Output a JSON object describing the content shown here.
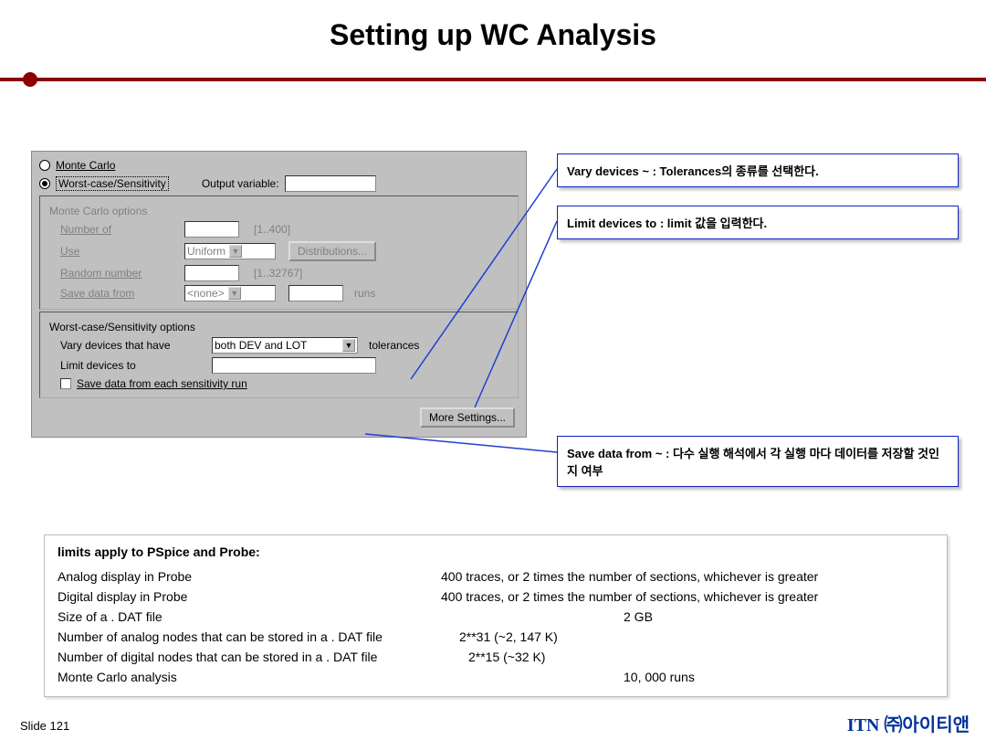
{
  "title": "Setting up WC Analysis",
  "dialog": {
    "radio_mc": "Monte Carlo",
    "radio_wc": "Worst-case/Sensitivity",
    "output_var_label": "Output variable:",
    "output_var_value": "",
    "mc_group": "Monte Carlo options",
    "numof": "Number of",
    "numof_hint": "[1..400]",
    "use": "Use",
    "use_value": "Uniform",
    "dist_btn": "Distributions...",
    "random": "Random number",
    "random_hint": "[1..32767]",
    "savefrom": "Save data from",
    "savefrom_value": "<none>",
    "runs": "runs",
    "wc_group": "Worst-case/Sensitivity options",
    "vary_label": "Vary devices that have",
    "vary_value": "both DEV and LOT",
    "tolerances": "tolerances",
    "limit_label": "Limit devices to",
    "save_check": "Save data from each sensitivity run",
    "more_btn": "More Settings..."
  },
  "callout1": "Vary devices ~ : Tolerances의 종류를 선택한다.",
  "callout2": "Limit devices to : limit 값을 입력한다.",
  "callout3": "Save data from ~ : 다수 실행 해석에서 각 실행 마다 데이터를 저장할 것인지 여부",
  "info": {
    "header": "limits apply to PSpice and Probe:",
    "rows": [
      {
        "l": "Analog display in Probe",
        "v": "400 traces, or 2 times the number of sections, whichever is greater"
      },
      {
        "l": "Digital display in Probe",
        "v": "400 traces, or 2 times the number of sections, whichever is greater"
      },
      {
        "l": "Size of a . DAT file",
        "v": "2 GB"
      },
      {
        "l": "Number of analog nodes that can be stored in a . DAT file",
        "v": "2**31 (~2, 147 K)"
      },
      {
        "l": "Number of digital nodes that can be stored in a . DAT file",
        "v": "2**15 (~32 K)"
      },
      {
        "l": "Monte Carlo analysis",
        "v": "10, 000 runs"
      }
    ]
  },
  "slidenum": "Slide 121",
  "brand_en": "ITN",
  "brand_kr": "㈜아이티앤"
}
